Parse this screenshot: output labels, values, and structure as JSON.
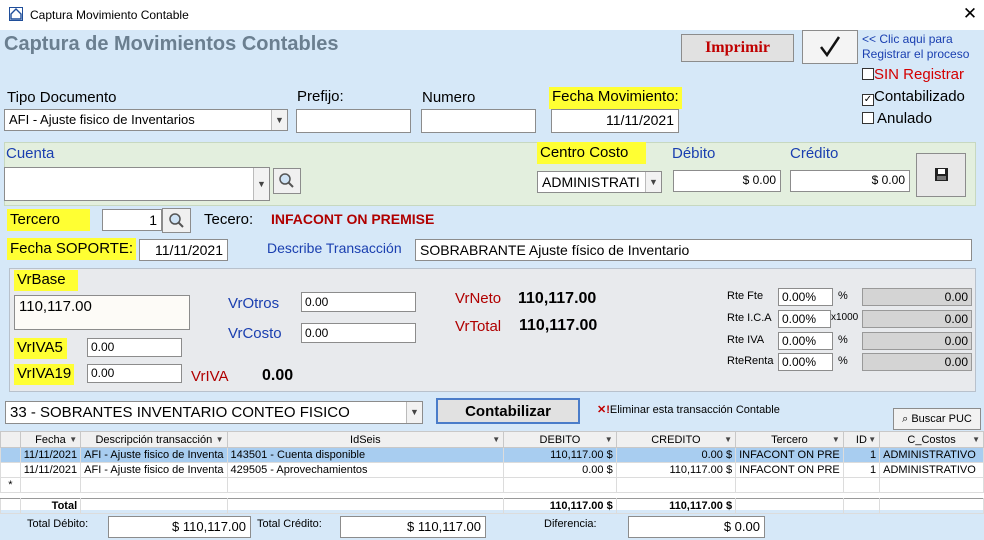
{
  "window": {
    "title": "Captura Movimiento Contable",
    "close_glyph": "✕"
  },
  "header": {
    "title": "Captura de Movimientos Contables",
    "print_label": "Imprimir",
    "register_hint_line1": "<< Clic aqui para",
    "register_hint_line2": "Registrar el proceso",
    "sin_registrar": "SIN Registrar",
    "contabilizado": "Contabilizado",
    "anulado": "Anulado"
  },
  "form": {
    "tipo_documento_label": "Tipo Documento",
    "tipo_documento_value": "AFI - Ajuste fisico de Inventarios",
    "prefijo_label": "Prefijo:",
    "prefijo_value": "",
    "numero_label": "Numero",
    "numero_value": "",
    "fecha_mov_label": "Fecha Movimiento:",
    "fecha_mov_value": "11/11/2021",
    "cuenta_label": "Cuenta",
    "cuenta_value": "",
    "centro_costo_label": "Centro Costo",
    "centro_costo_value": "ADMINISTRATI",
    "debito_label": "Débito",
    "debito_value": "$ 0.00",
    "credito_label": "Crédito",
    "credito_value": "$ 0.00",
    "tercero_label": "Tercero",
    "tercero_value": "1",
    "tecero_label": "Tecero:",
    "tecero_name": "INFACONT ON PREMISE",
    "fecha_soporte_label": "Fecha SOPORTE:",
    "fecha_soporte_value": "11/11/2021",
    "describe_label": "Describe Transacción",
    "describe_value": "SOBRABRANTE Ajuste físico de Inventario"
  },
  "values": {
    "vrbase_label": "VrBase",
    "vrbase_value": "110,117.00",
    "vrotros_label": "VrOtros",
    "vrotros_value": "0.00",
    "vrcosto_label": "VrCosto",
    "vrcosto_value": "0.00",
    "vrneto_label": "VrNeto",
    "vrneto_value": "110,117.00",
    "vrtotal_label": "VrTotal",
    "vrtotal_value": "110,117.00",
    "vriva5_label": "VrIVA5",
    "vriva5_value": "0.00",
    "vriva19_label": "VrIVA19",
    "vriva19_value": "0.00",
    "vriva_label": "VrIVA",
    "vriva_value": "0.00",
    "rte": [
      {
        "label": "Rte Fte",
        "pct": "0.00%",
        "unit": "%",
        "out": "0.00"
      },
      {
        "label": "Rte I.C.A",
        "pct": "0.00%",
        "unit": "x1000",
        "out": "0.00"
      },
      {
        "label": "Rte IVA",
        "pct": "0.00%",
        "unit": "%",
        "out": "0.00"
      },
      {
        "label": "RteRenta",
        "pct": "0.00%",
        "unit": "%",
        "out": "0.00"
      }
    ]
  },
  "action": {
    "concepto_value": "33 - SOBRANTES INVENTARIO CONTEO FISICO",
    "contabilizar_label": "Contabilizar",
    "eliminar_label": "Eliminar esta transacción Contable",
    "buscar_puc_label": "Buscar PUC"
  },
  "grid": {
    "headers": [
      "Fecha",
      "Descripción transacción",
      "IdSeis",
      "DEBITO",
      "CREDITO",
      "Tercero",
      "ID",
      "C_Costos"
    ],
    "rows": [
      [
        "11/11/2021",
        "AFI - Ajuste fisico de Inventa",
        "143501 - Cuenta disponible",
        "110,117.00 $",
        "0.00 $",
        "INFACONT ON PRE",
        "1",
        "ADMINISTRATIVO"
      ],
      [
        "11/11/2021",
        "AFI - Ajuste fisico de Inventa",
        "429505 - Aprovechamientos",
        "0.00 $",
        "110,117.00 $",
        "INFACONT ON PRE",
        "1",
        "ADMINISTRATIVO"
      ]
    ],
    "new_row_marker": "*",
    "total_label": "Total",
    "total_debito": "110,117.00 $",
    "total_credito": "110,117.00 $"
  },
  "footer": {
    "total_debito_label": "Total Débito:",
    "total_debito_value": "$ 110,117.00",
    "total_credito_label": "Total Crédito:",
    "total_credito_value": "$ 110,117.00",
    "diferencia_label": "Diferencia:",
    "diferencia_value": "$ 0.00"
  }
}
